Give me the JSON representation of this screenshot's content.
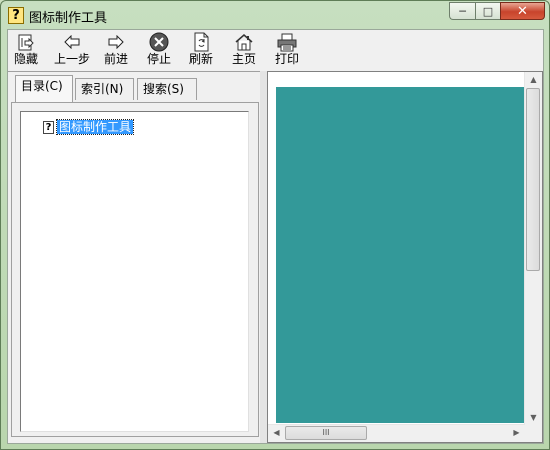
{
  "window": {
    "title": "图标制作工具",
    "app_icon_glyph": "?",
    "buttons": {
      "minimize": "─",
      "maximize": "□",
      "close": "✕"
    }
  },
  "toolbar": [
    {
      "id": "hide",
      "label": "隐藏",
      "icon": "hide-icon"
    },
    {
      "id": "back",
      "label": "上一步",
      "icon": "back-arrow-icon"
    },
    {
      "id": "forward",
      "label": "前进",
      "icon": "forward-arrow-icon"
    },
    {
      "id": "stop",
      "label": "停止",
      "icon": "stop-icon"
    },
    {
      "id": "refresh",
      "label": "刷新",
      "icon": "refresh-icon"
    },
    {
      "id": "home",
      "label": "主页",
      "icon": "home-icon"
    },
    {
      "id": "print",
      "label": "打印",
      "icon": "print-icon"
    }
  ],
  "tabs": [
    {
      "label": "目录(C)",
      "active": true
    },
    {
      "label": "索引(N)",
      "active": false
    },
    {
      "label": "搜索(S)",
      "active": false
    }
  ],
  "tree": {
    "items": [
      {
        "label": "图标制作工具",
        "icon": "help-topic-icon",
        "icon_glyph": "?"
      }
    ]
  },
  "content": {
    "background": "#339999"
  },
  "scrollbars": {
    "hthumb_grip": "III"
  }
}
